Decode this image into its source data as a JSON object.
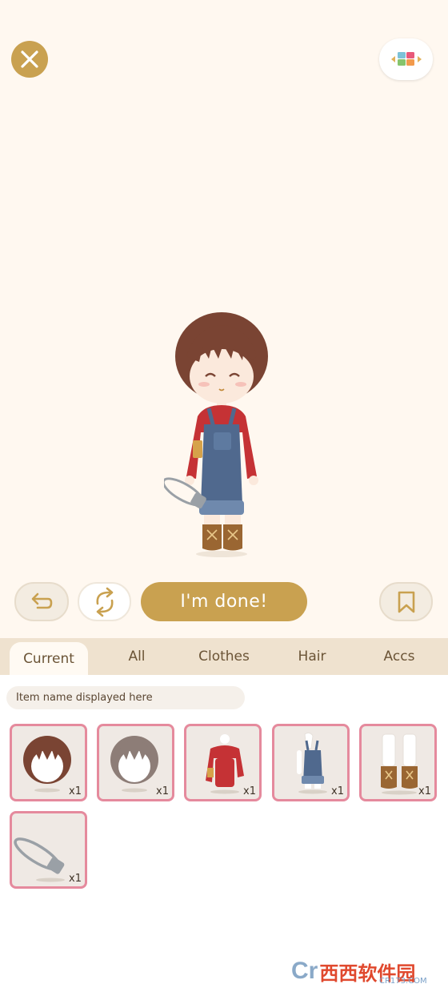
{
  "toolbar": {
    "done_label": "I'm done!"
  },
  "tabs": [
    {
      "label": "Current"
    },
    {
      "label": "All"
    },
    {
      "label": "Clothes"
    },
    {
      "label": "Hair"
    },
    {
      "label": "Accs"
    }
  ],
  "item_name_placeholder": "Item name displayed here",
  "items": [
    {
      "icon": "brown-bob-hair",
      "qty": "x1"
    },
    {
      "icon": "gray-bob-hair",
      "qty": "x1"
    },
    {
      "icon": "red-sweater",
      "qty": "x1"
    },
    {
      "icon": "denim-overalls",
      "qty": "x1"
    },
    {
      "icon": "brown-lace-boots",
      "qty": "x1"
    },
    {
      "icon": "safety-pin",
      "qty": "x1"
    }
  ],
  "watermark": {
    "logo": "Cr",
    "text": "西西软件园",
    "sub": "CR173.COM"
  },
  "colors": {
    "accent": "#c9a150",
    "slot_border": "#e58a9d",
    "tab_bar": "#efe2cf"
  }
}
